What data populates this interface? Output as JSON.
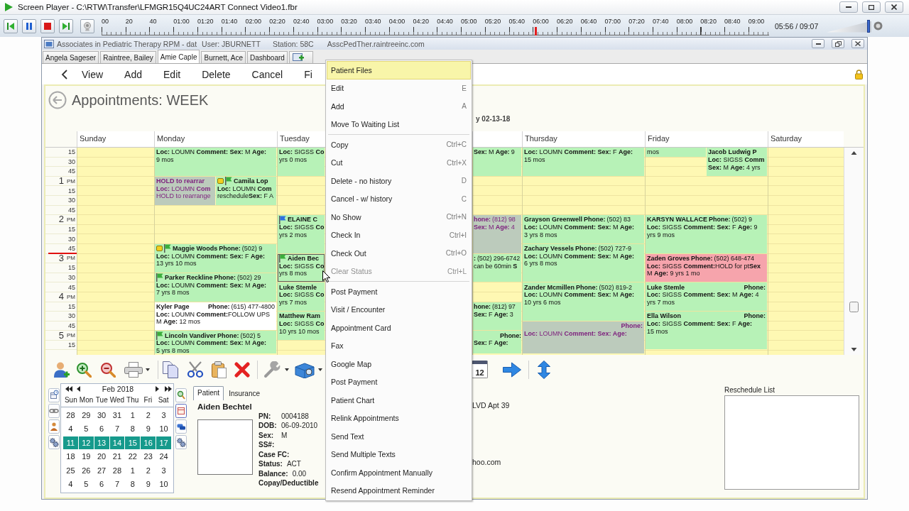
{
  "player": {
    "title": "Screen Player - C:\\RTW\\Transfer\\LFMGR15Q4UC24ART Connect Video1.fbr",
    "timeline": {
      "ticks": [
        "00",
        "20",
        "40",
        "01:00",
        "01:20",
        "01:40",
        "02:00",
        "02:20",
        "02:40",
        "03:00",
        "03:20",
        "03:40",
        "04:00",
        "04:20",
        "04:40",
        "05:00",
        "05:20",
        "05:40",
        "06:00",
        "06:20",
        "06:40",
        "07:00",
        "07:20",
        "07:40",
        "08:00",
        "08:20",
        "08:40",
        "09:00"
      ],
      "level": 0.65
    },
    "time": "05:56 / 09:07",
    "volume": {
      "level": 0.97
    }
  },
  "app": {
    "title": "Associates in Pediatric Therapy RPM - dat",
    "user": "User: JBURNETT",
    "station": "Station: 58C",
    "host": "AsscPedTher.raintreeinc.com",
    "tabs": [
      {
        "label": "Angela Sageser",
        "selected": false
      },
      {
        "label": "Raintree, Bailey",
        "selected": false
      },
      {
        "label": "Amie Caple",
        "selected": true
      },
      {
        "label": "Burnett, Ace",
        "selected": false
      },
      {
        "label": "Dashboard",
        "selected": false
      }
    ],
    "toolbar": [
      "View",
      "Add",
      "Edit",
      "Delete",
      "Cancel",
      "Fi"
    ]
  },
  "calendar": {
    "title": "Appointments: WEEK",
    "date_caption": "y 02-13-18",
    "time_slots": [
      {
        "label": "15"
      },
      {
        "label": "30"
      },
      {
        "label": "45"
      },
      {
        "label": "1",
        "suffix": "PM"
      },
      {
        "label": "15"
      },
      {
        "label": "30"
      },
      {
        "label": "45"
      },
      {
        "label": "2",
        "suffix": "PM"
      },
      {
        "label": "15"
      },
      {
        "label": "30"
      },
      {
        "label": "45"
      },
      {
        "label": "3",
        "suffix": "PM"
      },
      {
        "label": "15"
      },
      {
        "label": "30"
      },
      {
        "label": "45"
      },
      {
        "label": "4",
        "suffix": "PM"
      },
      {
        "label": "15"
      },
      {
        "label": "30"
      },
      {
        "label": "45"
      },
      {
        "label": "5",
        "suffix": "PM"
      },
      {
        "label": "15"
      }
    ],
    "days": [
      {
        "name": "Sunday"
      },
      {
        "name": "Monday",
        "appointments": [
          {
            "kind": "booked",
            "color": "#b7f2b7",
            "note": false,
            "selected": false,
            "lines": [
              "**Loc:** LOUMN **Comment: Sex:** M **Age:**",
              "9 mos"
            ]
          },
          {
            "kind": "held",
            "color": "#bccbbc",
            "note": false,
            "selected": false,
            "name": "HOLD to rearrar",
            "lines": [
              "**Loc:** LOUMN **Com**",
              "HOLD to rearrange"
            ]
          },
          {
            "kind": "booked",
            "color": "#b7f2b7",
            "note": true,
            "flag": {
              "color": "#3cae3c"
            },
            "selected": false,
            "name": "Camila Lop",
            "lines": [
              "**Loc:** LOUMN **Com**",
              "reschedule**Sex:** F A"
            ]
          },
          {
            "kind": "booked",
            "color": "#b7f2b7",
            "note": true,
            "flag": {
              "color": "#3cae3c"
            },
            "selected": false,
            "name": "Maggie Woods",
            "phone_label": "Phone:",
            "phone_number": "(502) 9",
            "phone_tabbed": false,
            "lines": [
              "**Loc:** LOUMN **Comment: Sex:** F **Age:**",
              "13 yrs 10 mos"
            ]
          },
          {
            "kind": "booked",
            "color": "#b7f2b7",
            "note": false,
            "flag": {
              "color": "#3cae3c"
            },
            "selected": false,
            "name": "Parker Reckline",
            "phone_label": "Phone:",
            "phone_number": "(502) 29",
            "phone_tabbed": false,
            "lines": [
              "**Loc:** LOUMN **Comment: Sex:** M **Age:**",
              "7 yrs 8 mos"
            ]
          },
          {
            "kind": "booked",
            "color": "#ffffff",
            "note": false,
            "selected": false,
            "name": "Kyler Page",
            "phone_label": "Phone:",
            "phone_number": "(615) 477-4800",
            "phone_tabbed": true,
            "lines": [
              "**Loc:** LOUMN **Comment:**FOLLOW UPS",
              "M **Age:** 12 mos"
            ]
          },
          {
            "kind": "booked",
            "color": "#b7f2b7",
            "note": false,
            "flag": {
              "color": "#3cae3c"
            },
            "selected": false,
            "name": "Lincoln Vandiver",
            "phone_label": "Phone:",
            "phone_number": "(502) 5",
            "phone_tabbed": false,
            "lines": [
              "**Loc:** LOUMN **Comment: Sex:** M **Age:**",
              "5 yrs 8 mos"
            ]
          }
        ]
      },
      {
        "name": "Tuesday",
        "appointments": [
          {
            "kind": "booked",
            "color": "#b7f2b7",
            "note": false,
            "selected": false,
            "lines": [
              "**Loc:** SIGSS **Co**",
              "yrs 0 mos"
            ]
          },
          {
            "kind": "booked",
            "color": "#b7f2b7",
            "note": false,
            "flag": {
              "color": "#2f6fe0"
            },
            "selected": false,
            "name": "ELAINE C",
            "lines": [
              "**Loc:** SIGSS **Co**",
              "yrs 2 mos"
            ]
          },
          {
            "kind": "booked",
            "color": "#b7f2b7",
            "note": false,
            "flag": {
              "color": "#3cae3c"
            },
            "selected": true,
            "name": "Aiden Bec",
            "lines": [
              "**Loc:** SIGSS **Co**",
              "yrs 8 mos"
            ]
          },
          {
            "kind": "booked",
            "color": "#b7f2b7",
            "note": false,
            "selected": false,
            "name": "Luke Stemle",
            "lines": [
              "**Loc:** SIGSS **Co**",
              "yrs 7 mos"
            ]
          },
          {
            "kind": "booked",
            "color": "#b7f2b7",
            "note": false,
            "selected": false,
            "name": "Matthew Ram",
            "lines": [
              "**Loc:** SIGSS **Co**",
              "10 yrs 10 mos"
            ]
          }
        ]
      },
      {
        "appointments": [
          {
            "kind": "booked",
            "color": "#b7f2b7",
            "note": false,
            "selected": false,
            "lines": [
              "**Sex:** M **Age:** 9"
            ]
          },
          {
            "kind": "held",
            "color": "#bccbbc",
            "note": false,
            "selected": false,
            "phone_label": "hone:",
            "phone_number": "(812) 98",
            "phone_tabbed": false,
            "lines": [
              "**Sex:** M **Age:** 4"
            ]
          },
          {
            "kind": "booked",
            "color": "#b7f2b7",
            "note": false,
            "selected": false,
            "phone_label": ":",
            "phone_number": "(502) 296-6742",
            "phone_tabbed": false,
            "lines": [
              "can be 60min **S**"
            ]
          },
          {
            "kind": "booked",
            "color": "#b7f2b7",
            "note": false,
            "selected": false,
            "phone_label": "hone:",
            "phone_number": "(812) 97",
            "phone_tabbed": false,
            "lines": [
              "**Sex:** F **Age:** 3"
            ]
          },
          {
            "kind": "booked",
            "color": "#b7f2b7",
            "note": false,
            "selected": false,
            "phone_label": "Phone:",
            "phone_tabbed": true,
            "lines": [
              "**Sex:** F **Age:**"
            ]
          }
        ]
      },
      {
        "name": "Thursday",
        "appointments": [
          {
            "kind": "booked",
            "color": "#b7f2b7",
            "note": false,
            "selected": false,
            "lines": [
              "**Loc:** LOUMN **Comment: Sex:** F **Age:**",
              "15 mos"
            ]
          },
          {
            "kind": "booked",
            "color": "#b7f2b7",
            "note": false,
            "selected": false,
            "name": "Grayson Greenwell",
            "phone_label": "Phone:",
            "phone_number": "(502) 83",
            "phone_tabbed": false,
            "lines": [
              "**Loc:** LOUMN **Comment: Sex:** M **Age:**",
              "3 yrs 8 mos"
            ]
          },
          {
            "kind": "booked",
            "color": "#b7f2b7",
            "note": false,
            "selected": false,
            "name": "Zachary Vessels",
            "phone_label": "Phone:",
            "phone_number": "(502) 727-9",
            "phone_tabbed": false,
            "lines": [
              "**Loc:** LOUMN **Comment: Sex:** M **Age:**",
              "6 yrs 8 mos"
            ]
          },
          {
            "kind": "booked",
            "color": "#b7f2b7",
            "note": false,
            "selected": false,
            "name": "Zander Mcmillen",
            "phone_label": "Phone:",
            "phone_number": "(502) 819-2",
            "phone_tabbed": false,
            "lines": [
              "**Loc:** LOUMN **Comment: Sex:** M **Age:**",
              "10 yrs 6 mos"
            ]
          },
          {
            "kind": "held",
            "color": "#bccbbc",
            "note": false,
            "selected": false,
            "phone_label": "Phone:",
            "phone_tabbed": true,
            "lines": [
              "**Loc:** LOUMN **Comment: Sex: Age:**"
            ]
          }
        ]
      },
      {
        "name": "Friday",
        "appointments": [
          {
            "kind": "booked",
            "color": "#b7f2b7",
            "note": false,
            "selected": false,
            "lines": [
              "mos"
            ]
          },
          {
            "kind": "booked",
            "color": "#b7f2b7",
            "note": false,
            "selected": false,
            "name": "Jacob Ludwig P",
            "lines": [
              "**Loc:** SIGSS **Comm**",
              "**Sex:** M **Age:** 4 yrs"
            ]
          },
          {
            "kind": "booked",
            "color": "#b7f2b7",
            "note": false,
            "selected": false,
            "name": "KARSYN WALLACE",
            "phone_label": "Phone:",
            "phone_number": "(502) 9",
            "phone_tabbed": false,
            "lines": [
              "**Loc:** SIGSS **Comment: Sex:** F **Age:** 9",
              "yrs 9 mos"
            ]
          },
          {
            "kind": "booked",
            "color": "#f6a4ac",
            "note": false,
            "selected": false,
            "name": "Zaden Groves",
            "phone_label": "Phone:",
            "phone_number": "(502) 648-474",
            "phone_tabbed": false,
            "lines": [
              "**Loc:** SIGSS **Comment:**HOLD for pt**Sex**",
              "M **Age:** 9 yrs 1 mo"
            ]
          },
          {
            "kind": "booked",
            "color": "#b7f2b7",
            "note": false,
            "selected": false,
            "name": "Luke Stemle",
            "phone_label": "Phone:",
            "phone_tabbed": true,
            "lines": [
              "**Loc:** SIGSS **Comment: Sex:** M **Age:** 4",
              "yrs 7 mos"
            ]
          },
          {
            "kind": "booked",
            "color": "#b7f2b7",
            "note": false,
            "selected": false,
            "name": "Ella Wilson",
            "phone_label": "Phone:",
            "phone_tabbed": true,
            "lines": [
              "**Loc:** SIGSS **Comment: Sex:** F **Age:**",
              "15 mos"
            ]
          }
        ]
      },
      {
        "name": "Saturday"
      }
    ]
  },
  "context_menu": {
    "sections": [
      {
        "items": [
          {
            "label": "Patient Files",
            "selected": true,
            "disabled": false
          },
          {
            "label": "Edit",
            "shortcut": "E",
            "selected": false,
            "disabled": false
          },
          {
            "label": "Add",
            "shortcut": "A",
            "selected": false,
            "disabled": false
          },
          {
            "label": "Move To Waiting List",
            "selected": false,
            "disabled": false
          }
        ]
      },
      {
        "items": [
          {
            "label": "Copy",
            "shortcut": "Ctrl+C",
            "selected": false,
            "disabled": false
          },
          {
            "label": "Cut",
            "shortcut": "Ctrl+X",
            "selected": false,
            "disabled": false
          },
          {
            "label": "Delete - no history",
            "shortcut": "D",
            "selected": false,
            "disabled": false
          },
          {
            "label": "Cancel - w/ history",
            "shortcut": "C",
            "selected": false,
            "disabled": false
          },
          {
            "label": "No Show",
            "shortcut": "Ctrl+N",
            "selected": false,
            "disabled": false
          },
          {
            "label": "Check In",
            "shortcut": "Ctrl+I",
            "selected": false,
            "disabled": false
          },
          {
            "label": "Check Out",
            "shortcut": "Ctrl+O",
            "selected": false,
            "disabled": false
          },
          {
            "label": "Clear Status",
            "shortcut": "Ctrl+L",
            "selected": false,
            "disabled": true
          }
        ]
      },
      {
        "items": [
          {
            "label": "Post Payment",
            "selected": false,
            "disabled": false
          },
          {
            "label": "Visit / Encounter",
            "selected": false,
            "disabled": false
          },
          {
            "label": "Appointment Card",
            "selected": false,
            "disabled": false
          },
          {
            "label": "Fax",
            "selected": false,
            "disabled": false
          },
          {
            "label": "Google Map",
            "selected": false,
            "disabled": false
          },
          {
            "label": "Post Payment",
            "selected": false,
            "disabled": false
          },
          {
            "label": "Patient Chart",
            "selected": false,
            "disabled": false
          },
          {
            "label": "Relink Appointments",
            "selected": false,
            "disabled": false
          },
          {
            "label": "Send Text",
            "selected": false,
            "disabled": false
          },
          {
            "label": "Send Multiple Texts",
            "selected": false,
            "disabled": false
          },
          {
            "label": "Confirm Appointment Manually",
            "selected": false,
            "disabled": false
          },
          {
            "label": "Resend Appointment Reminder",
            "selected": false,
            "disabled": false
          }
        ]
      }
    ]
  },
  "bottom": {
    "today_day": "12",
    "mini_calendar": {
      "month": "Feb 2018",
      "weekdays": [
        "Sun",
        "Mon",
        "Tue",
        "Wed",
        "Thu",
        "Fri",
        "Sat"
      ],
      "weeks": [
        {
          "days": [
            "28",
            "29",
            "30",
            "31",
            "1",
            "2",
            "3"
          ],
          "selected": false
        },
        {
          "days": [
            "4",
            "5",
            "6",
            "7",
            "8",
            "9",
            "10"
          ],
          "selected": false
        },
        {
          "days": [
            "11",
            "12",
            "13",
            "14",
            "15",
            "16",
            "17"
          ],
          "selected": true
        },
        {
          "days": [
            "18",
            "19",
            "20",
            "21",
            "22",
            "23",
            "24"
          ],
          "selected": false
        },
        {
          "days": [
            "25",
            "26",
            "27",
            "28",
            "1",
            "2",
            "3"
          ],
          "selected": false
        },
        {
          "days": [
            "4",
            "5",
            "6",
            "7",
            "8",
            "9",
            "10"
          ],
          "selected": false
        }
      ]
    },
    "patient_tabs": [
      {
        "label": "Patient",
        "selected": true
      },
      {
        "label": "Insurance",
        "selected": false
      }
    ],
    "patient": {
      "name": "Aiden Bechtel",
      "fields": [
        {
          "label": "PN:",
          "value": "0004188"
        },
        {
          "label": "DOB:",
          "value": "06-09-2010"
        },
        {
          "label": "Sex:",
          "value": "M"
        },
        {
          "label": "SS#:"
        },
        {
          "label": "Case FC:"
        },
        {
          "label": "Status:",
          "value": "ACT"
        },
        {
          "label": "Balance:",
          "value": "0.00"
        },
        {
          "label": "Copay/Deductible"
        }
      ]
    },
    "address_fragment": "LVD Apt 39",
    "email_fragment": "hoo.com",
    "reschedule_list": {
      "label": "Reschedule List"
    }
  }
}
